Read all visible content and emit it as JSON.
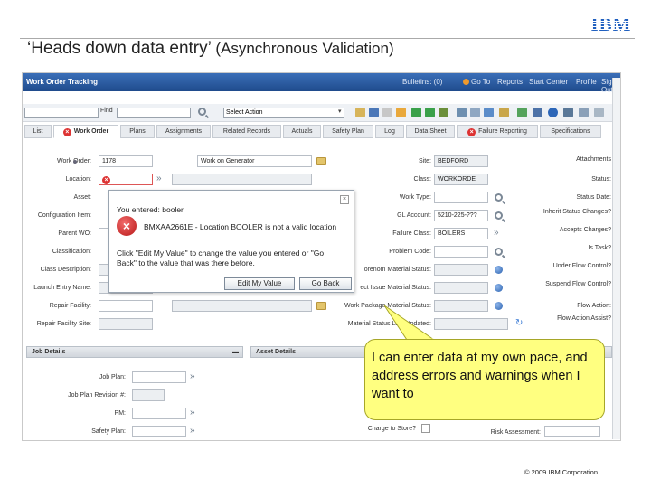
{
  "slide": {
    "title_main": "‘Heads down data entry’",
    "title_sub": "(Asynchronous Validation)",
    "logo": "IBM",
    "copyright": "© 2009 IBM Corporation"
  },
  "app": {
    "title": "Work Order Tracking",
    "nav": [
      "Bulletins: (0)",
      "Go To",
      "Reports",
      "Start Center",
      "Profile",
      "Sign Out"
    ],
    "toolbar": {
      "find_label": "Find",
      "action_select": "Select Action"
    },
    "tabs": [
      "List",
      "Work Order",
      "Plans",
      "Assignments",
      "Related Records",
      "Actuals",
      "Safety Plan",
      "Log",
      "Data Sheet",
      "Failure Reporting",
      "Specifications"
    ],
    "left_fields": [
      {
        "label": "Work Order:",
        "value": "1178",
        "desc": "Work on Generator"
      },
      {
        "label": "Location:",
        "value": "",
        "desc": ""
      },
      {
        "label": "Asset:",
        "value": "",
        "desc": ""
      },
      {
        "label": "Configuration Item:",
        "value": "",
        "desc": ""
      },
      {
        "label": "Parent WO:",
        "value": "",
        "desc": ""
      },
      {
        "label": "Classification:",
        "value": "",
        "desc": ""
      },
      {
        "label": "Class Description:",
        "value": "",
        "desc": ""
      },
      {
        "label": "Launch Entry Name:",
        "value": "",
        "desc": ""
      },
      {
        "label": "Repair Facility:",
        "value": "",
        "desc": ""
      },
      {
        "label": "Repair Facility Site:",
        "value": "",
        "desc": ""
      }
    ],
    "mid_fields": [
      {
        "label": "Site:",
        "value": "BEDFORD"
      },
      {
        "label": "Class:",
        "value": "WORKORDE"
      },
      {
        "label": "Work Type:",
        "value": ""
      },
      {
        "label": "GL Account:",
        "value": "5210-225-???"
      },
      {
        "label": "Failure Class:",
        "value": "BOILERS"
      },
      {
        "label": "Problem Code:",
        "value": ""
      },
      {
        "label": "orenom Material Status:",
        "value": ""
      },
      {
        "label": "Under Flow Control?",
        "value": ""
      },
      {
        "label": "ect Issue Material Status:",
        "value": ""
      },
      {
        "label": "Work Package Material Status:",
        "value": ""
      },
      {
        "label": "Material Status Last Updated:",
        "value": ""
      }
    ],
    "right_labels": [
      "Attachments",
      "Status:",
      "Status Date:",
      "Inherit Status Changes?",
      "Accepts Charges?",
      "Is Task?",
      "Under Flow Control?",
      "Suspend Flow Control?",
      "Flow Action:",
      "Flow Action Assist?"
    ],
    "dialog": {
      "line1": "You entered: booler",
      "line2": "BMXAA2661E - Location BOOLER is not a valid location",
      "line3": "Click \"Edit My Value\" to change the value you entered or \"Go",
      "line4": "Back\" to the value that was there before.",
      "edit_button": "Edit My Value",
      "back_button": "Go Back"
    },
    "job_details": {
      "header": "Job Details",
      "labels": [
        "Job Plan:",
        "Job Plan Revision #:",
        "PM:",
        "Safety Plan:"
      ]
    },
    "asset_details": {
      "header": "Asset Details",
      "labels": [
        "Charge to Store?",
        "Risk Assessment:"
      ]
    }
  },
  "callout": {
    "text": "I can enter data at my own pace, and address errors and warnings when I want to"
  }
}
